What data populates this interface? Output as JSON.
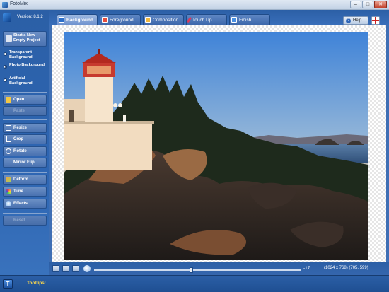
{
  "window": {
    "title": "FotoMix",
    "minimize": "–",
    "maximize": "□",
    "close": "✕"
  },
  "sidebar": {
    "version": "Version: 8.1.2",
    "start_project": "Start a New Empty Project",
    "background_options": [
      {
        "label": "Transparent Background",
        "selected": false
      },
      {
        "label": "Photo Background",
        "selected": true
      },
      {
        "label": "Artificial Background",
        "selected": false
      }
    ],
    "buttons": {
      "open": "Open",
      "paste": "Paste",
      "resize": "Resize",
      "crop": "Crop",
      "rotate": "Rotate",
      "mirror_flip": "Mirror Flip",
      "deform": "Deform",
      "tune": "Tune",
      "effects": "Effects",
      "reset": "Reset"
    }
  },
  "tabs": [
    {
      "label": "Background",
      "active": true,
      "icon": "background-icon"
    },
    {
      "label": "Foreground",
      "active": false,
      "icon": "foreground-icon"
    },
    {
      "label": "Composition",
      "active": false,
      "icon": "composition-icon"
    },
    {
      "label": "Touch Up",
      "active": false,
      "icon": "touchup-icon"
    },
    {
      "label": "Finish",
      "active": false,
      "icon": "finish-icon"
    }
  ],
  "help_label": "Help",
  "bottom": {
    "zoom_value": "-17",
    "zoom_slider_percent": 47,
    "image_info": "(1024 x 768) (705, 599)"
  },
  "status": {
    "tooltips_label": "Tooltips:",
    "tip_icon": "T"
  },
  "colors": {
    "accent": "#2e66b3",
    "tooltips": "#ffd94a"
  }
}
